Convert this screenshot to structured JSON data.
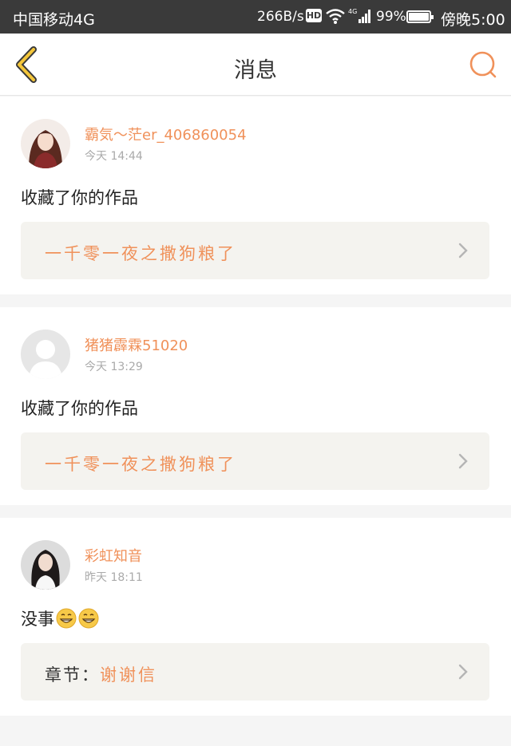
{
  "status_bar": {
    "carrier": "中国移动4G",
    "net_speed": "266B/s",
    "hd": "HD",
    "battery_pct": "99%",
    "time": "傍晚5:00"
  },
  "header": {
    "title": "消息"
  },
  "messages": [
    {
      "username": "霸気～茫er_406860054",
      "time": "今天 14:44",
      "action": "收藏了你的作品",
      "work_title": "一千零一夜之撒狗粮了"
    },
    {
      "username": "猪猪霹霖51020",
      "time": "今天 13:29",
      "action": "收藏了你的作品",
      "work_title": "一千零一夜之撒狗粮了"
    },
    {
      "username": "彩虹知音",
      "time": "昨天 18:11",
      "action": "没事",
      "work_prefix": "章节：",
      "work_title": "谢谢信"
    }
  ],
  "colors": {
    "accent": "#f0915a",
    "back_arrow": "#f4c63a",
    "status_bar_bg": "#3a3a3a"
  }
}
